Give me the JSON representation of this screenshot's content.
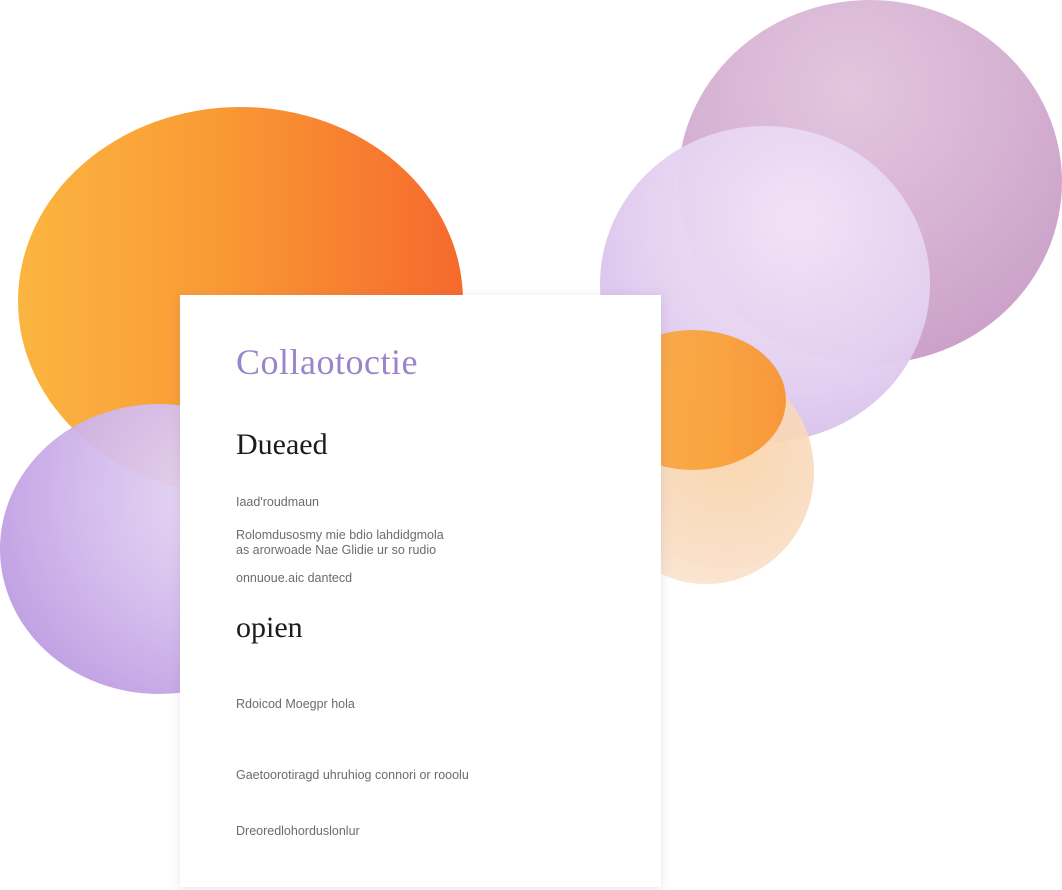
{
  "document": {
    "title": "Collaotoctie",
    "section_1_heading": "Dueaed",
    "meta_line": "Iaad'roudmaun",
    "paragraph_lines": [
      "Rolomdusosmy mie bdio lahdidgmola",
      "as arorwoade Nae Glidie ur so rudio",
      "onnuoue.aic dantecd"
    ],
    "section_2_heading": "opien",
    "item_lines": [
      "Rdoicod Moegpr hola",
      "Gaetoorotiragd uhruhiog connori or rooolu",
      "Dreoredlohorduslonlur"
    ]
  },
  "colors": {
    "orange": "#f99a35",
    "purple": "#c7a8e6",
    "mauve": "#d5b0d2",
    "lavender": "#e4d1f1",
    "title_accent": "#9a85c9"
  }
}
